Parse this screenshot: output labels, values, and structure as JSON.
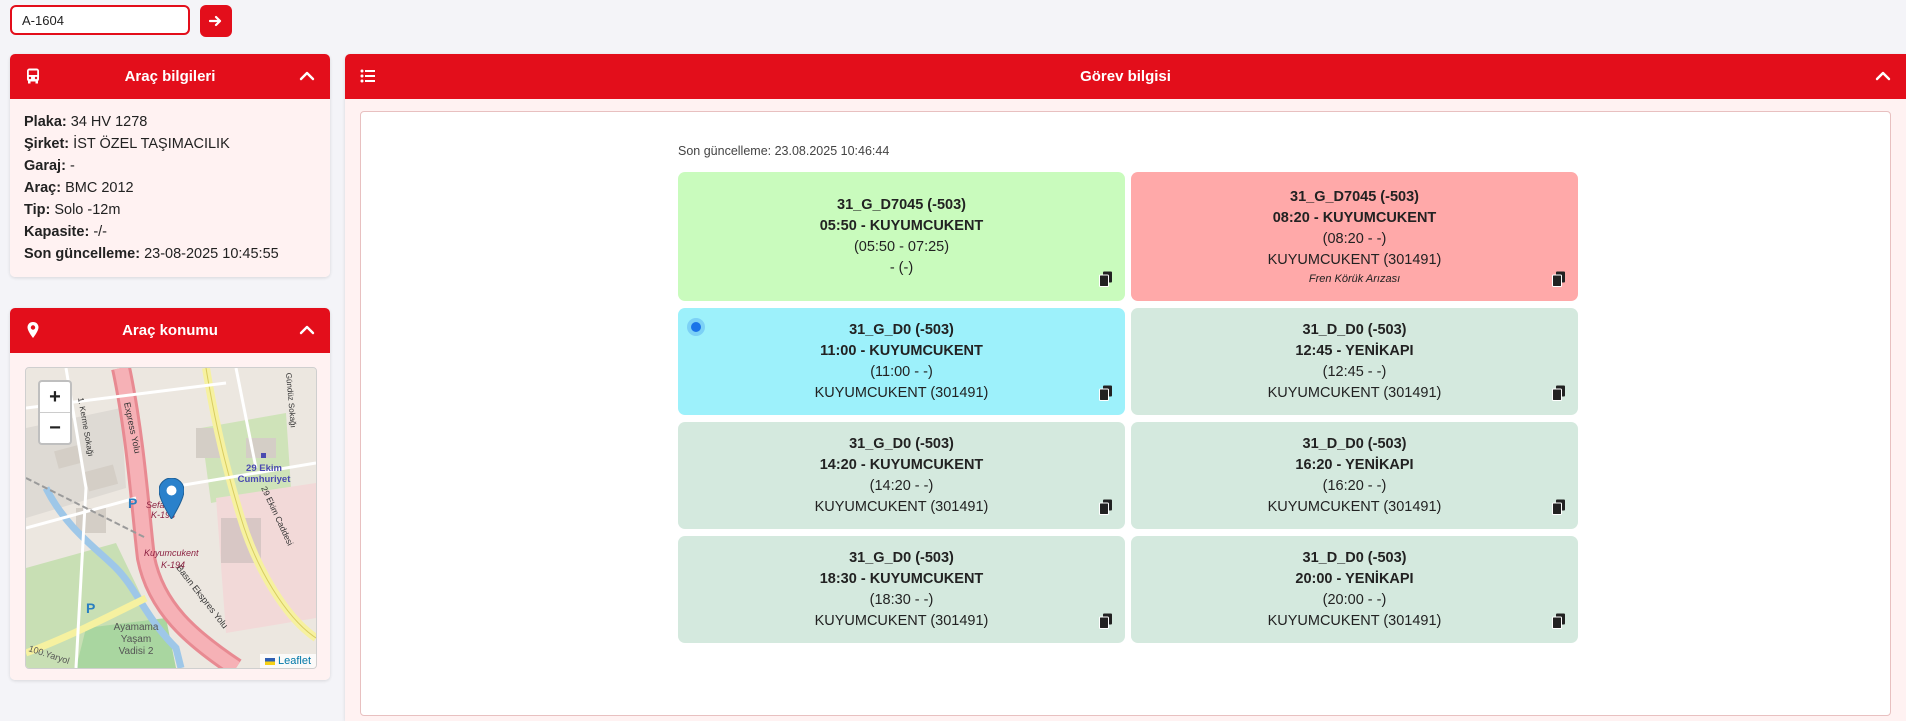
{
  "search": {
    "value": "A-1604",
    "button_icon": "arrow-right-icon"
  },
  "vehicle_info": {
    "title": "Araç bilgileri",
    "rows": [
      {
        "label": "Plaka:",
        "value": "34 HV 1278"
      },
      {
        "label": "Şirket:",
        "value": "İST ÖZEL TAŞIMACILIK"
      },
      {
        "label": "Garaj:",
        "value": "-"
      },
      {
        "label": "Araç:",
        "value": "BMC 2012"
      },
      {
        "label": "Tip:",
        "value": "Solo -12m"
      },
      {
        "label": "Kapasite:",
        "value": "-/-"
      },
      {
        "label": "Son güncelleme:",
        "value": "23-08-2025 10:45:55"
      }
    ]
  },
  "vehicle_location": {
    "title": "Araç konumu",
    "zoom_in": "+",
    "zoom_out": "−",
    "attribution": "Leaflet",
    "map_labels": {
      "street1": "Express Yolu",
      "street2": "Basın Ekspres Yolu",
      "street3": "29 Ekim Caddesi",
      "street4": "1. Kerme Sokağı",
      "street5": "Gündüz Sokağı",
      "place1": "29 Ekim",
      "place2": "Cumhuriyet",
      "stop1": "Sefaköy",
      "stop1b": "K-193",
      "stop2": "Kuyumcukent",
      "stop2b": "K-194",
      "area1": "Ayamama",
      "area2": "Yaşam",
      "area3": "Vadisi 2",
      "road": "100.Yaryol",
      "parking": "P"
    }
  },
  "task_info": {
    "title": "Görev bilgisi",
    "last_update": "Son güncelleme: 23.08.2025 10:46:44",
    "cards": [
      {
        "code": "31_G_D7045 (-503)",
        "time_dest": "05:50 - KUYUMCUKENT",
        "range": "(05:50 - 07:25)",
        "stop": "- (-)",
        "note": "",
        "color": "#c9fbbd",
        "active": false
      },
      {
        "code": "31_G_D7045 (-503)",
        "time_dest": "08:20 - KUYUMCUKENT",
        "range": "(08:20 - -)",
        "stop": "KUYUMCUKENT (301491)",
        "note": "Fren Körük Arızası",
        "color": "#ffa9a9",
        "active": false
      },
      {
        "code": "31_G_D0 (-503)",
        "time_dest": "11:00 - KUYUMCUKENT",
        "range": "(11:00 - -)",
        "stop": "KUYUMCUKENT (301491)",
        "note": "",
        "color": "#9df1fb",
        "active": true
      },
      {
        "code": "31_D_D0 (-503)",
        "time_dest": "12:45 - YENİKAPI",
        "range": "(12:45 - -)",
        "stop": "KUYUMCUKENT (301491)",
        "note": "",
        "color": "#d4e9de",
        "active": false
      },
      {
        "code": "31_G_D0 (-503)",
        "time_dest": "14:20 - KUYUMCUKENT",
        "range": "(14:20 - -)",
        "stop": "KUYUMCUKENT (301491)",
        "note": "",
        "color": "#d4e9de",
        "active": false
      },
      {
        "code": "31_D_D0 (-503)",
        "time_dest": "16:20 - YENİKAPI",
        "range": "(16:20 - -)",
        "stop": "KUYUMCUKENT (301491)",
        "note": "",
        "color": "#d4e9de",
        "active": false
      },
      {
        "code": "31_G_D0 (-503)",
        "time_dest": "18:30 - KUYUMCUKENT",
        "range": "(18:30 - -)",
        "stop": "KUYUMCUKENT (301491)",
        "note": "",
        "color": "#d4e9de",
        "active": false
      },
      {
        "code": "31_D_D0 (-503)",
        "time_dest": "20:00 - YENİKAPI",
        "range": "(20:00 - -)",
        "stop": "KUYUMCUKENT (301491)",
        "note": "",
        "color": "#d4e9de",
        "active": false
      }
    ]
  },
  "colors": {
    "accent": "#e30e1b",
    "panel_bg": "#fff2f2"
  }
}
